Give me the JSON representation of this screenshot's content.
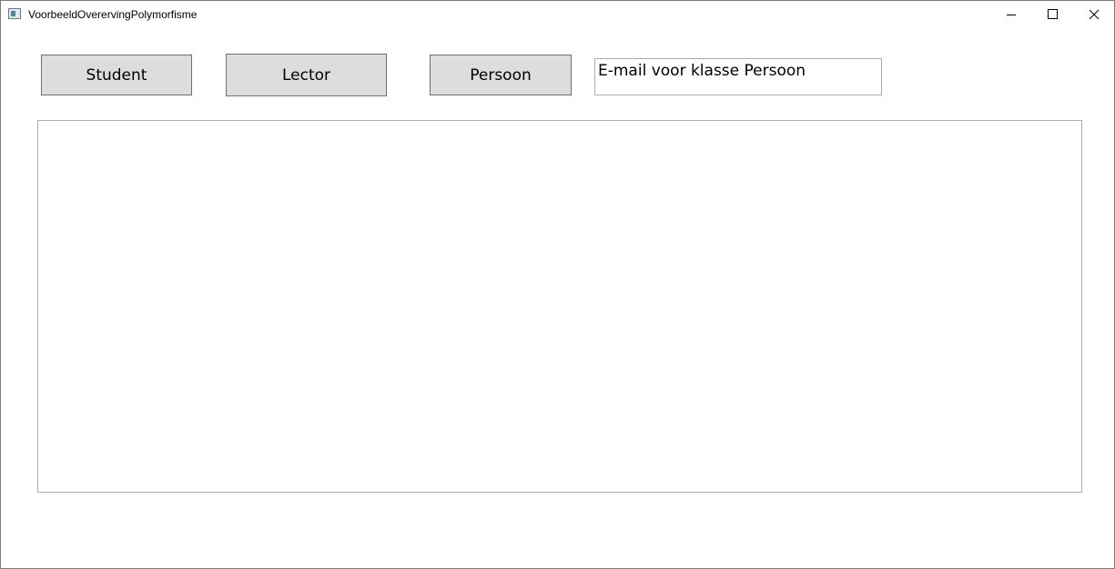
{
  "window": {
    "title": "VoorbeeldOvererving​Polymorfisme"
  },
  "icons": {
    "app": "app-window-icon",
    "minimize": "minimize-icon",
    "maximize": "maximize-icon",
    "close": "close-icon"
  },
  "buttons": {
    "student": "Student",
    "lector": "Lector",
    "persoon": "Persoon"
  },
  "email_textbox": {
    "value": "E-mail voor klasse Persoon"
  },
  "output_textbox": {
    "value": ""
  }
}
